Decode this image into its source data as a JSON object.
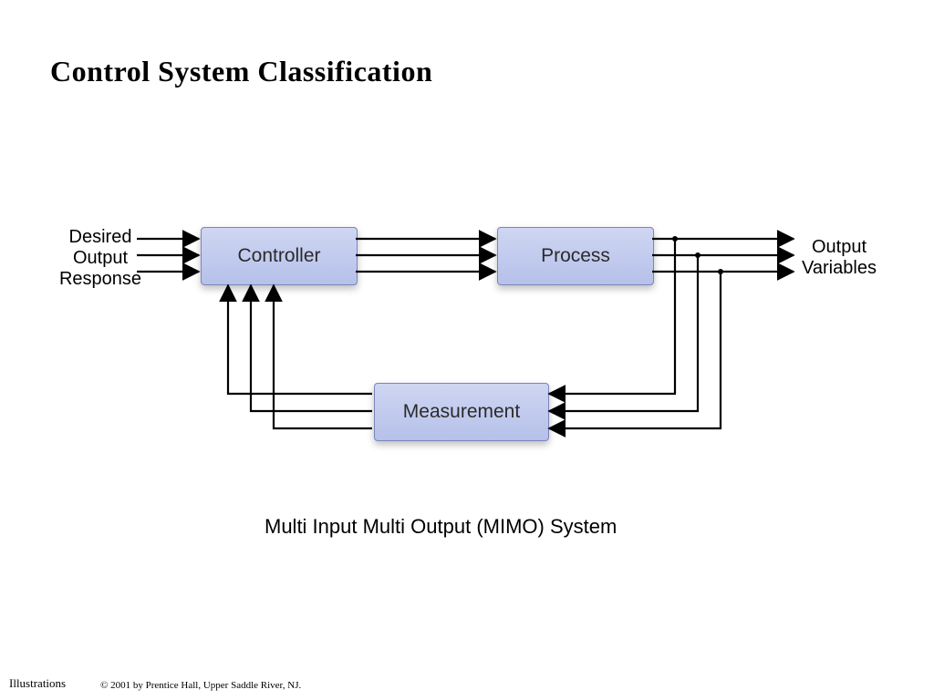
{
  "title": "Control  System Classification",
  "input_label": "Desired\nOutput\nResponse",
  "output_label": "Output\nVariables",
  "blocks": {
    "controller": "Controller",
    "process": "Process",
    "measurement": "Measurement"
  },
  "caption": "Multi Input Multi Output (MIMO) System",
  "footer": {
    "left": "Illustrations",
    "copyright": "© 2001 by Prentice Hall, Upper Saddle River, NJ."
  },
  "diagram_semantics": {
    "type": "closed-loop-mimo-block-diagram",
    "nodes": [
      "Desired Output Response",
      "Controller",
      "Process",
      "Output Variables",
      "Measurement"
    ],
    "edges": [
      {
        "from": "Desired Output Response",
        "to": "Controller",
        "multiplicity": 3
      },
      {
        "from": "Controller",
        "to": "Process",
        "multiplicity": 3
      },
      {
        "from": "Process",
        "to": "Output Variables",
        "multiplicity": 3
      },
      {
        "from": "Output Variables",
        "to": "Measurement",
        "multiplicity": 3,
        "note": "tap-off"
      },
      {
        "from": "Measurement",
        "to": "Controller",
        "multiplicity": 3,
        "note": "feedback"
      }
    ]
  }
}
